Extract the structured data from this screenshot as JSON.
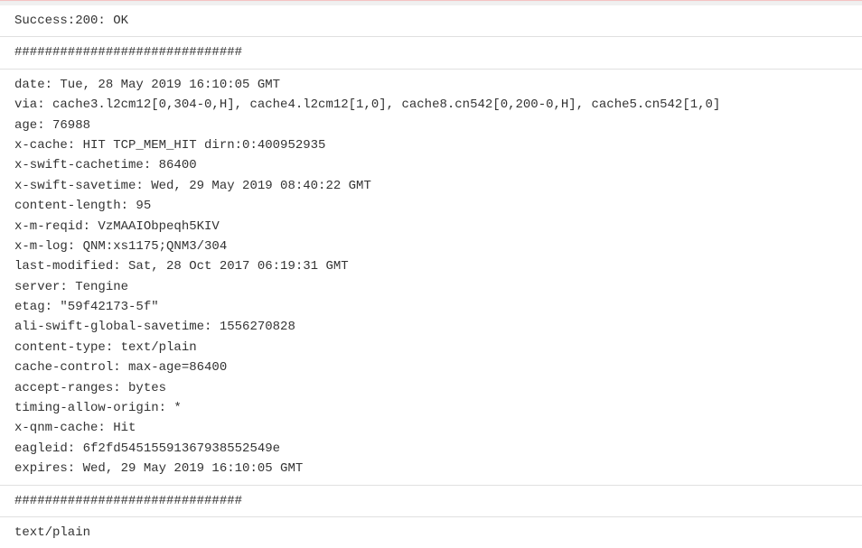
{
  "status": {
    "label": "Success:",
    "code": "200:",
    "text": "OK"
  },
  "separator1": "##############################",
  "headers": {
    "date": "date: Tue, 28 May 2019 16:10:05 GMT",
    "via": "via: cache3.l2cm12[0,304-0,H], cache4.l2cm12[1,0], cache8.cn542[0,200-0,H], cache5.cn542[1,0]",
    "age": "age: 76988",
    "x_cache": "x-cache: HIT TCP_MEM_HIT dirn:0:400952935",
    "x_swift_cachetime": "x-swift-cachetime: 86400",
    "x_swift_savetime": "x-swift-savetime: Wed, 29 May 2019 08:40:22 GMT",
    "content_length": "content-length: 95",
    "x_m_reqid": "x-m-reqid: VzMAAIObpeqh5KIV",
    "x_m_log": "x-m-log: QNM:xs1175;QNM3/304",
    "last_modified": "last-modified: Sat, 28 Oct 2017 06:19:31 GMT",
    "server": "server: Tengine",
    "etag": "etag: \"59f42173-5f\"",
    "ali_swift_global_savetime": "ali-swift-global-savetime: 1556270828",
    "content_type": "content-type: text/plain",
    "cache_control": "cache-control: max-age=86400",
    "accept_ranges": "accept-ranges: bytes",
    "timing_allow_origin": "timing-allow-origin: *",
    "x_qnm_cache": "x-qnm-cache: Hit",
    "eagleid": "eagleid: 6f2fd54515591367938552549e",
    "expires": "expires: Wed, 29 May 2019 16:10:05 GMT"
  },
  "separator2": "##############################",
  "body_content_type": "text/plain"
}
